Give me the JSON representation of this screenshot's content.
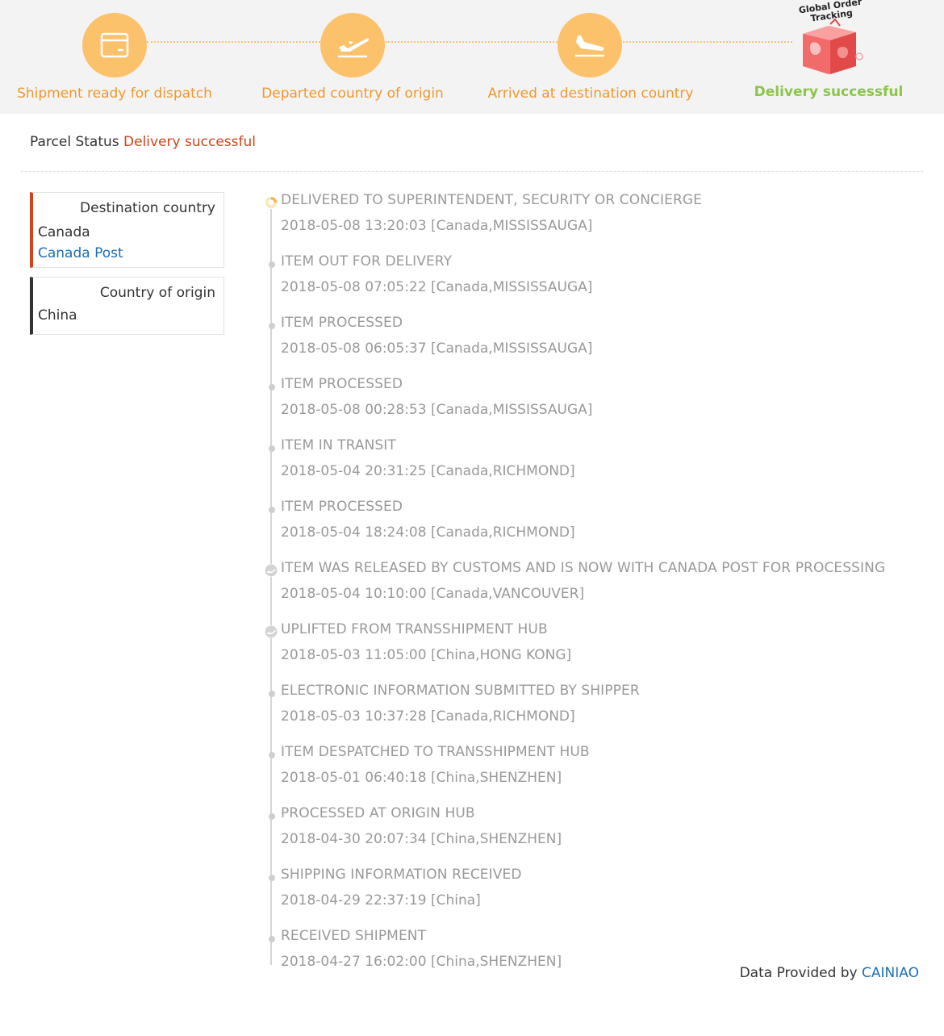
{
  "progress": {
    "steps": [
      {
        "label": "Shipment ready for dispatch",
        "icon": "package-icon"
      },
      {
        "label": "Departed country of origin",
        "icon": "plane-takeoff-icon"
      },
      {
        "label": "Arrived at destination country",
        "icon": "plane-landing-icon"
      },
      {
        "label": "Delivery successful",
        "icon": "global-order-tracking-box-icon"
      }
    ],
    "badge_text": "Global Order Tracking"
  },
  "status": {
    "label": "Parcel Status",
    "value": "Delivery successful"
  },
  "destination": {
    "heading": "Destination country",
    "country": "Canada",
    "carrier": "Canada Post"
  },
  "origin": {
    "heading": "Country of origin",
    "country": "China"
  },
  "events": [
    {
      "title": "DELIVERED TO SUPERINTENDENT, SECURITY OR CONCIERGE",
      "time": "2018-05-08 13:20:03",
      "location": "[Canada,MISSISSAUGA]"
    },
    {
      "title": "ITEM OUT FOR DELIVERY",
      "time": "2018-05-08 07:05:22",
      "location": "[Canada,MISSISSAUGA]"
    },
    {
      "title": "ITEM PROCESSED",
      "time": "2018-05-08 06:05:37",
      "location": "[Canada,MISSISSAUGA]"
    },
    {
      "title": "ITEM PROCESSED",
      "time": "2018-05-08 00:28:53",
      "location": "[Canada,MISSISSAUGA]"
    },
    {
      "title": "ITEM IN TRANSIT",
      "time": "2018-05-04 20:31:25",
      "location": "[Canada,RICHMOND]"
    },
    {
      "title": "ITEM PROCESSED",
      "time": "2018-05-04 18:24:08",
      "location": "[Canada,RICHMOND]"
    },
    {
      "title": "ITEM WAS RELEASED BY CUSTOMS AND IS NOW WITH CANADA POST FOR PROCESSING",
      "time": "2018-05-04 10:10:00",
      "location": "[Canada,VANCOUVER]"
    },
    {
      "title": "UPLIFTED FROM TRANSSHIPMENT HUB",
      "time": "2018-05-03 11:05:00",
      "location": "[China,HONG KONG]"
    },
    {
      "title": "ELECTRONIC INFORMATION SUBMITTED BY SHIPPER",
      "time": "2018-05-03 10:37:28",
      "location": "[Canada,RICHMOND]"
    },
    {
      "title": "ITEM DESPATCHED TO TRANSSHIPMENT HUB",
      "time": "2018-05-01 06:40:18",
      "location": "[China,SHENZHEN]"
    },
    {
      "title": "PROCESSED AT ORIGIN HUB",
      "time": "2018-04-30 20:07:34",
      "location": "[China,SHENZHEN]"
    },
    {
      "title": "SHIPPING INFORMATION RECEIVED",
      "time": "2018-04-29 22:37:19",
      "location": "[China]"
    },
    {
      "title": "RECEIVED SHIPMENT",
      "time": "2018-04-27 16:02:00",
      "location": "[China,SHENZHEN]"
    }
  ],
  "footer": {
    "prefix": "Data Provided by",
    "provider": "CAINIAO"
  },
  "colors": {
    "step_circle": "#fcc16b",
    "step_label": "#f0982d",
    "success": "#8cc54a",
    "status_value": "#d1431d",
    "link": "#1a6fb5",
    "event_text": "#999999"
  }
}
